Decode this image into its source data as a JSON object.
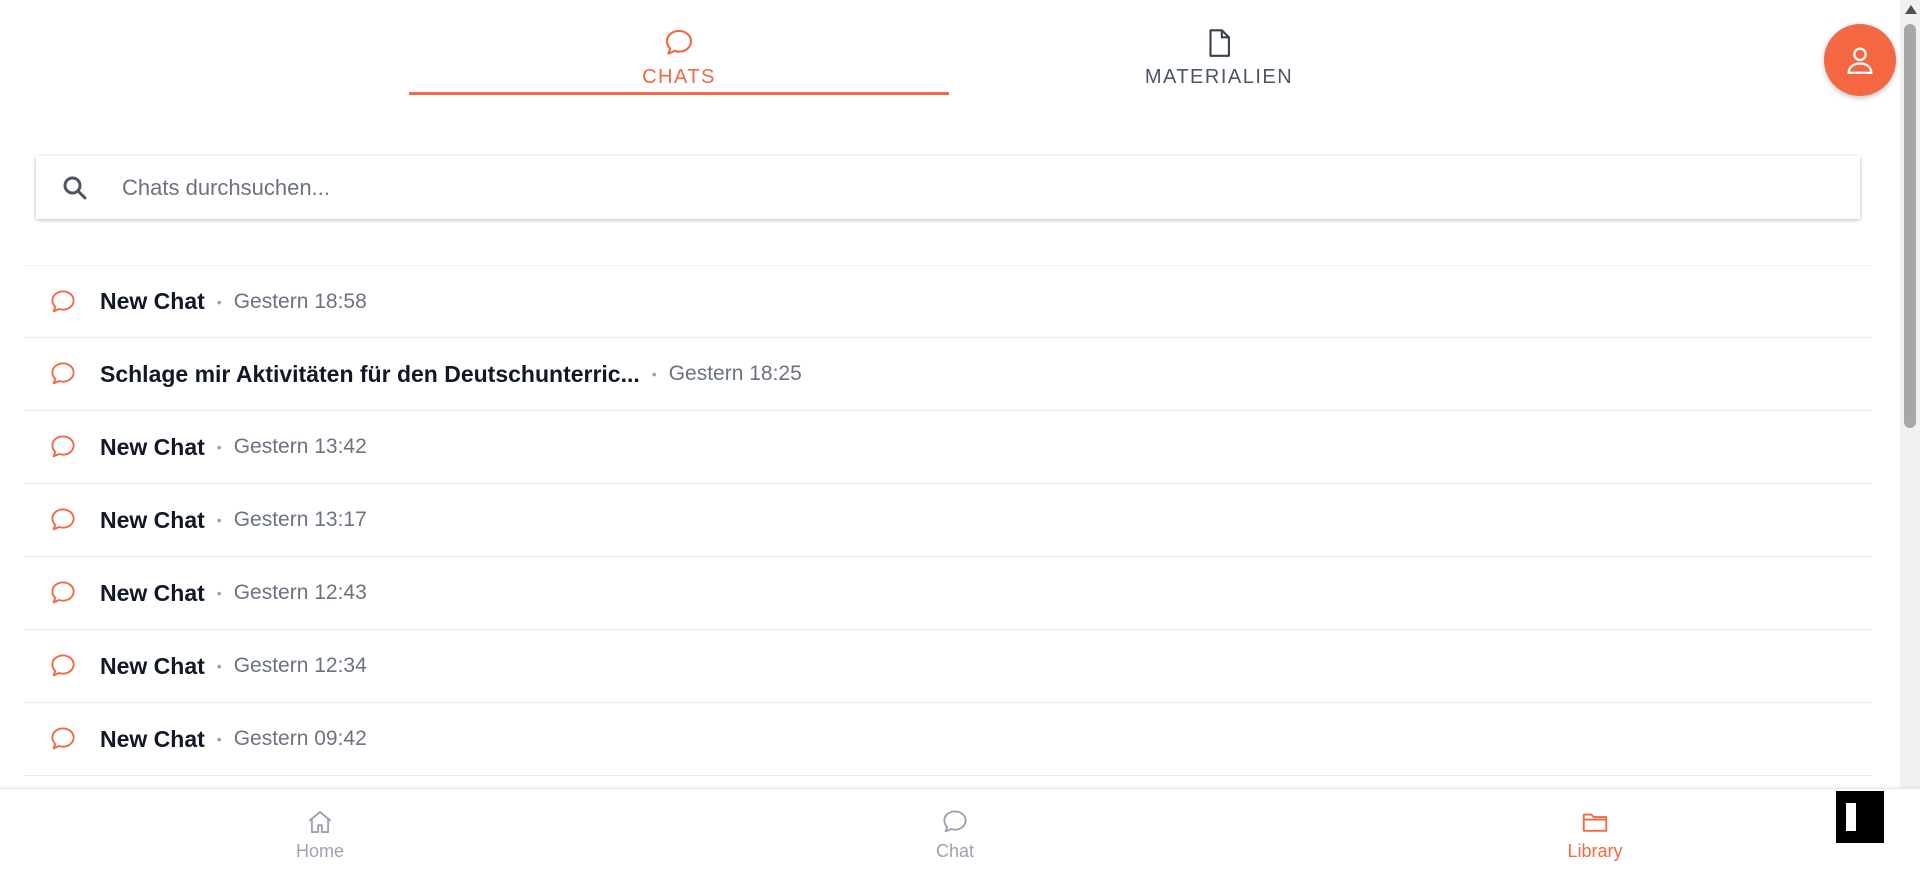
{
  "tabs": [
    {
      "label": "CHATS",
      "icon": "chat-bubble-icon",
      "active": true
    },
    {
      "label": "MATERIALIEN",
      "icon": "document-icon",
      "active": false
    }
  ],
  "search": {
    "placeholder": "Chats durchsuchen...",
    "icon": "search-icon"
  },
  "chats": [
    {
      "title": "New Chat",
      "time": "Gestern 18:58"
    },
    {
      "title": "Schlage mir Aktivitäten für den Deutschunterric...",
      "time": "Gestern 18:25"
    },
    {
      "title": "New Chat",
      "time": "Gestern 13:42"
    },
    {
      "title": "New Chat",
      "time": "Gestern 13:17"
    },
    {
      "title": "New Chat",
      "time": "Gestern 12:43"
    },
    {
      "title": "New Chat",
      "time": "Gestern 12:34"
    },
    {
      "title": "New Chat",
      "time": "Gestern 09:42"
    }
  ],
  "separator": "•",
  "bottom_nav": [
    {
      "label": "Home",
      "icon": "home-icon",
      "active": false
    },
    {
      "label": "Chat",
      "icon": "chat-bubble-icon",
      "active": false
    },
    {
      "label": "Library",
      "icon": "folder-icon",
      "active": true
    }
  ],
  "colors": {
    "accent": "#f36843",
    "muted": "#9ca3af",
    "text": "#111827"
  }
}
